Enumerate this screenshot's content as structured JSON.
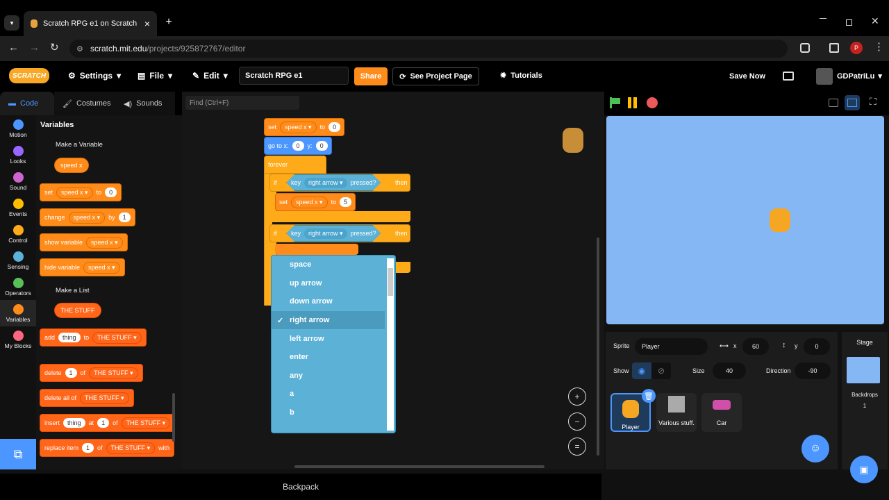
{
  "browser": {
    "tab_title": "Scratch RPG e1 on Scratch",
    "url_host": "scratch.mit.edu",
    "url_path": "/projects/925872767/editor",
    "new_tab": "+",
    "close": "×",
    "profile_initial": "P"
  },
  "menu": {
    "logo": "SCRATCH",
    "settings": "Settings",
    "file": "File",
    "edit": "Edit",
    "project_title": "Scratch RPG e1",
    "share": "Share",
    "see_project_page": "See Project Page",
    "tutorials": "Tutorials",
    "save_now": "Save Now",
    "username": "GDPatriLu"
  },
  "editor_tabs": {
    "code": "Code",
    "costumes": "Costumes",
    "sounds": "Sounds"
  },
  "find_placeholder": "Find (Ctrl+F)",
  "categories": [
    {
      "label": "Motion",
      "color": "#4c97ff"
    },
    {
      "label": "Looks",
      "color": "#9966ff"
    },
    {
      "label": "Sound",
      "color": "#cf63cf"
    },
    {
      "label": "Events",
      "color": "#ffbf00"
    },
    {
      "label": "Control",
      "color": "#ffab19"
    },
    {
      "label": "Sensing",
      "color": "#5cb1d6"
    },
    {
      "label": "Operators",
      "color": "#59c059"
    },
    {
      "label": "Variables",
      "color": "#ff8c1a"
    },
    {
      "label": "My Blocks",
      "color": "#ff6680"
    }
  ],
  "palette": {
    "heading": "Variables",
    "make_variable": "Make a Variable",
    "var_name": "speed x",
    "set": "set",
    "to": "to",
    "set_value": "0",
    "change": "change",
    "by": "by",
    "change_value": "1",
    "show_variable": "show variable",
    "hide_variable": "hide variable",
    "make_list": "Make a List",
    "list_name": "THE STUFF",
    "add": "add",
    "thing": "thing",
    "to2": "to",
    "delete": "delete",
    "of": "of",
    "one": "1",
    "delete_all_of": "delete all of",
    "insert": "insert",
    "at": "at",
    "replace_item": "replace item",
    "with": "with"
  },
  "script": {
    "set": "set",
    "var": "speed x",
    "to": "to",
    "zero": "0",
    "goto": "go to x:",
    "gx": "0",
    "y": "y:",
    "gy": "0",
    "forever": "forever",
    "if": "if",
    "key": "key",
    "key_value": "right arrow",
    "pressed": "pressed?",
    "then": "then",
    "set_value": "5"
  },
  "dropdown": {
    "options": [
      "space",
      "up arrow",
      "down arrow",
      "right arrow",
      "left arrow",
      "enter",
      "any",
      "a",
      "b"
    ],
    "selected_index": 3,
    "check": "✓"
  },
  "sprite_info": {
    "sprite_label": "Sprite",
    "sprite_name": "Player",
    "x_label": "x",
    "x": "60",
    "y_label": "y",
    "y": "0",
    "show_label": "Show",
    "size_label": "Size",
    "size": "40",
    "direction_label": "Direction",
    "direction": "-90"
  },
  "sprites": [
    "Player",
    "Various stuff.",
    "Car"
  ],
  "stage_pane": {
    "title": "Stage",
    "backdrops_label": "Backdrops",
    "backdrops_count": "1"
  },
  "backpack": "Backpack",
  "zoom": {
    "in": "+",
    "out": "−",
    "reset": "="
  }
}
